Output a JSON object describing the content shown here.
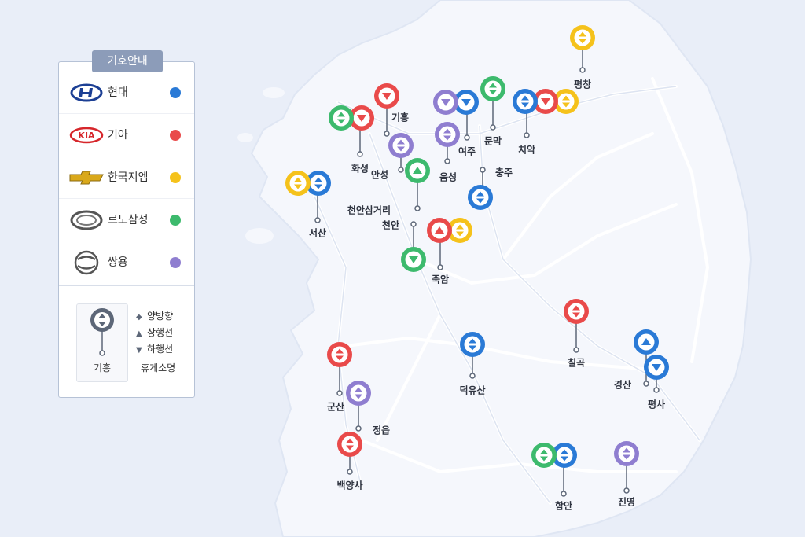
{
  "legend": {
    "title": "기호안내",
    "brands": [
      {
        "key": "hyundai",
        "name": "현대",
        "color": "#2a7ad6",
        "icon": "hyundai-logo"
      },
      {
        "key": "kia",
        "name": "기아",
        "color": "#e94a4a",
        "icon": "kia-logo"
      },
      {
        "key": "gm",
        "name": "한국지엠",
        "color": "#f5c21b",
        "icon": "chevrolet-logo"
      },
      {
        "key": "renault",
        "name": "르노삼성",
        "color": "#3dba6d",
        "icon": "renault-samsung-logo"
      },
      {
        "key": "ssangyong",
        "name": "쌍용",
        "color": "#8f7ed0",
        "icon": "ssangyong-logo"
      }
    ],
    "symbols": {
      "both": "양방향",
      "up": "상행선",
      "down": "하행선",
      "sample_name": "기흥",
      "rest_area": "휴게소명"
    }
  },
  "map": {
    "stops": [
      {
        "name": "기흥",
        "labelSide": "right",
        "pins": [
          {
            "brand": "kia",
            "dir": "down"
          }
        ]
      },
      {
        "name": "화성",
        "labelSide": "below",
        "pins": [
          {
            "brand": "renault",
            "dir": "both"
          },
          {
            "brand": "kia",
            "dir": "down"
          }
        ]
      },
      {
        "name": "안성",
        "labelSide": "left",
        "pins": [
          {
            "brand": "ssangyong",
            "dir": "both"
          }
        ]
      },
      {
        "name": "여주",
        "labelSide": "below",
        "pins": [
          {
            "brand": "ssangyong",
            "dir": "down"
          },
          {
            "brand": "hyundai",
            "dir": "down"
          }
        ]
      },
      {
        "name": "음성",
        "labelSide": "below",
        "pins": [
          {
            "brand": "ssangyong",
            "dir": "both"
          }
        ]
      },
      {
        "name": "문막",
        "labelSide": "below",
        "pins": [
          {
            "brand": "renault",
            "dir": "both"
          }
        ]
      },
      {
        "name": "치악",
        "labelSide": "below",
        "pins": [
          {
            "brand": "hyundai",
            "dir": "both"
          },
          {
            "brand": "kia",
            "dir": "down"
          },
          {
            "brand": "gm",
            "dir": "both"
          }
        ]
      },
      {
        "name": "평창",
        "labelSide": "below",
        "pins": [
          {
            "brand": "gm",
            "dir": "both"
          }
        ]
      },
      {
        "name": "서산",
        "labelSide": "below",
        "pins": [
          {
            "brand": "gm",
            "dir": "both"
          },
          {
            "brand": "hyundai",
            "dir": "both"
          }
        ]
      },
      {
        "name": "천안삼거리",
        "labelSide": "left",
        "pins": [
          {
            "brand": "renault",
            "dir": "up"
          }
        ]
      },
      {
        "name": "충주",
        "labelSide": "right",
        "pins": [
          {
            "brand": "hyundai",
            "dir": "both"
          }
        ]
      },
      {
        "name": "천안",
        "labelSide": "left",
        "pins": [
          {
            "brand": "renault",
            "dir": "down"
          }
        ]
      },
      {
        "name": "죽암",
        "labelSide": "below",
        "pins": [
          {
            "brand": "kia",
            "dir": "up"
          },
          {
            "brand": "gm",
            "dir": "both"
          }
        ]
      },
      {
        "name": "칠곡",
        "labelSide": "below",
        "pins": [
          {
            "brand": "kia",
            "dir": "both"
          }
        ]
      },
      {
        "name": "덕유산",
        "labelSide": "below",
        "pins": [
          {
            "brand": "hyundai",
            "dir": "both"
          }
        ]
      },
      {
        "name": "경산",
        "labelSide": "left",
        "pins": [
          {
            "brand": "hyundai",
            "dir": "up"
          }
        ]
      },
      {
        "name": "평사",
        "labelSide": "below",
        "pins": [
          {
            "brand": "hyundai",
            "dir": "down"
          }
        ]
      },
      {
        "name": "군산",
        "labelSide": "below",
        "pins": [
          {
            "brand": "kia",
            "dir": "both"
          }
        ]
      },
      {
        "name": "정읍",
        "labelSide": "right",
        "pins": [
          {
            "brand": "ssangyong",
            "dir": "both"
          }
        ]
      },
      {
        "name": "백양사",
        "labelSide": "below",
        "pins": [
          {
            "brand": "kia",
            "dir": "both"
          }
        ]
      },
      {
        "name": "함안",
        "labelSide": "below",
        "pins": [
          {
            "brand": "renault",
            "dir": "both"
          },
          {
            "brand": "hyundai",
            "dir": "both"
          }
        ]
      },
      {
        "name": "진영",
        "labelSide": "below",
        "pins": [
          {
            "brand": "ssangyong",
            "dir": "both"
          }
        ]
      }
    ]
  }
}
